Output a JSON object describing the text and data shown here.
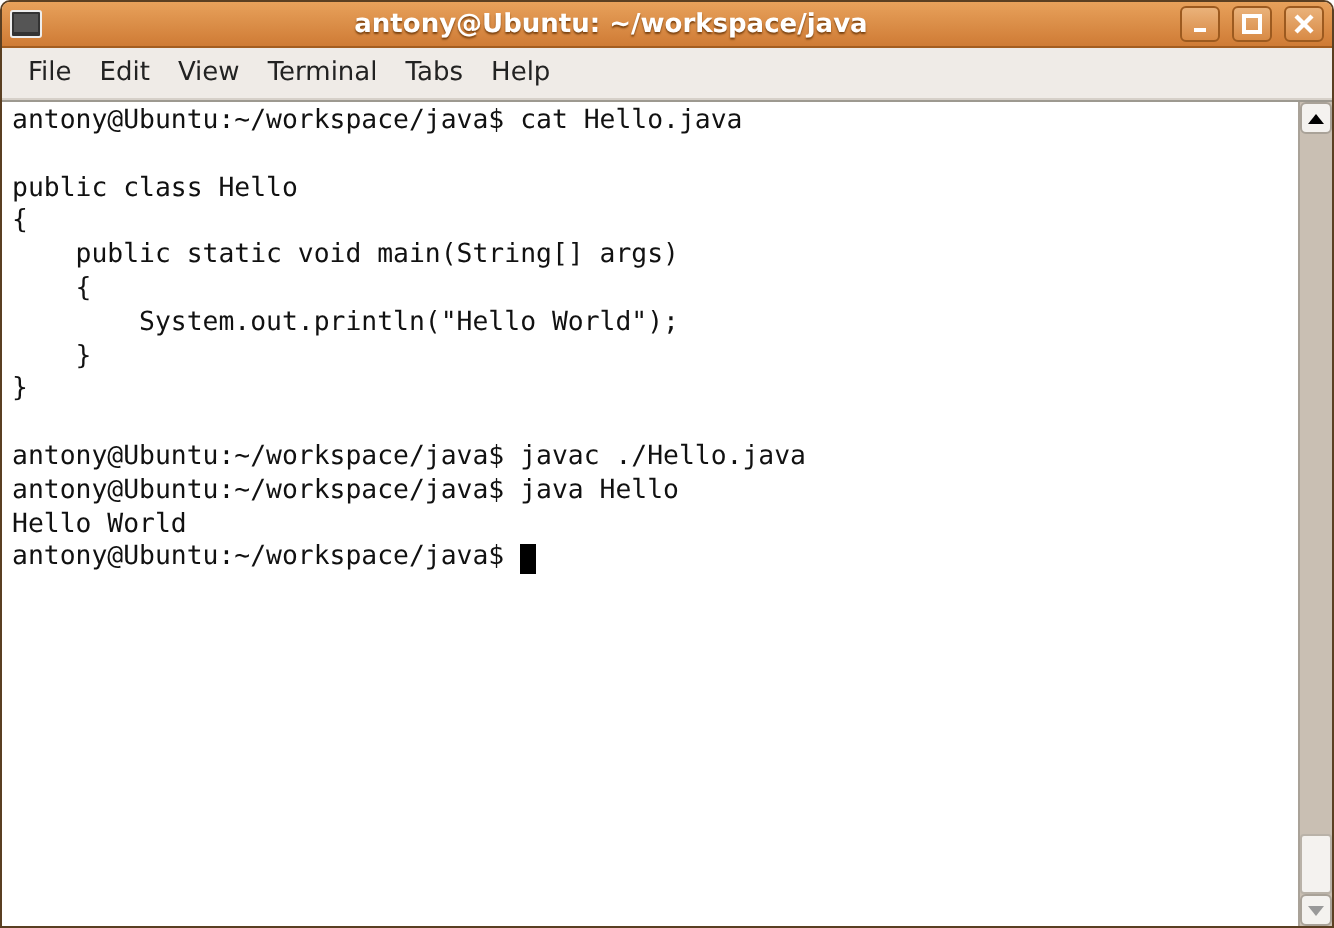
{
  "window": {
    "title": "antony@Ubuntu: ~/workspace/java"
  },
  "menu": [
    "File",
    "Edit",
    "View",
    "Terminal",
    "Tabs",
    "Help"
  ],
  "terminal": {
    "lines": [
      {
        "kind": "text",
        "text": "antony@Ubuntu:~/workspace/java$ cat Hello.java"
      },
      {
        "kind": "blank"
      },
      {
        "kind": "text",
        "text": "public class Hello"
      },
      {
        "kind": "text",
        "text": "{"
      },
      {
        "kind": "text",
        "text": "    public static void main(String[] args)"
      },
      {
        "kind": "text",
        "text": "    {"
      },
      {
        "kind": "text",
        "text": "        System.out.println(\"Hello World\");"
      },
      {
        "kind": "text",
        "text": "    }"
      },
      {
        "kind": "text",
        "text": "}"
      },
      {
        "kind": "blank"
      },
      {
        "kind": "text",
        "text": "antony@Ubuntu:~/workspace/java$ javac ./Hello.java"
      },
      {
        "kind": "text",
        "text": "antony@Ubuntu:~/workspace/java$ java Hello"
      },
      {
        "kind": "text",
        "text": "Hello World"
      },
      {
        "kind": "prompt",
        "text": "antony@Ubuntu:~/workspace/java$ "
      }
    ]
  }
}
